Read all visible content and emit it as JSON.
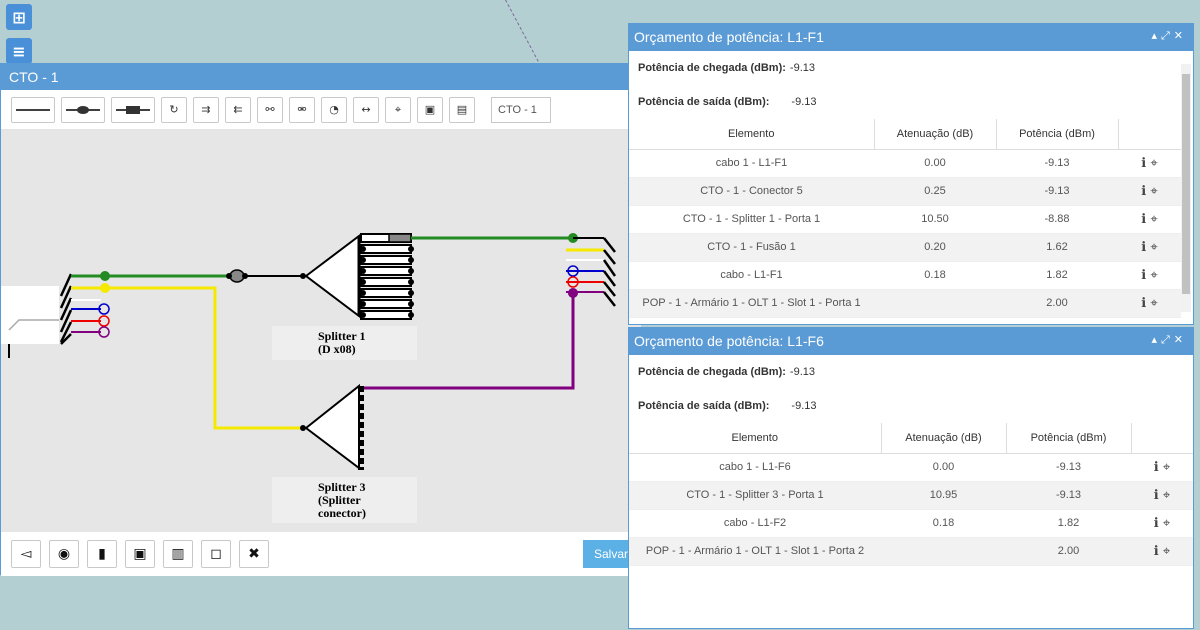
{
  "sidebar": {
    "add_icon": "plus-square-icon",
    "menu_icon": "menu-icon"
  },
  "cto": {
    "title": "CTO - 1",
    "name_value": "CTO - 1",
    "save_label": "Salvar",
    "splitters": [
      {
        "name": "Splitter 1",
        "detail": "(D x08)"
      },
      {
        "name": "Splitter 3",
        "detail": "(Splitter",
        "detail2": "conector)"
      }
    ]
  },
  "budgets": [
    {
      "title": "Orçamento de potência: L1-F1",
      "arrival_label": "Potência de chegada (dBm):",
      "arrival_value": "-9.13",
      "output_label": "Potência de saída (dBm):",
      "output_value": "-9.13",
      "headers": [
        "Elemento",
        "Atenuação (dB)",
        "Potência (dBm)"
      ],
      "rows": [
        {
          "element": "cabo 1 - L1-F1",
          "att": "0.00",
          "pow": "-9.13"
        },
        {
          "element": "CTO - 1 - Conector 5",
          "att": "0.25",
          "pow": "-9.13"
        },
        {
          "element": "CTO - 1 - Splitter 1 - Porta 1",
          "att": "10.50",
          "pow": "-8.88"
        },
        {
          "element": "CTO - 1 - Fusão 1",
          "att": "0.20",
          "pow": "1.62"
        },
        {
          "element": "cabo - L1-F1",
          "att": "0.18",
          "pow": "1.82"
        },
        {
          "element": "POP - 1 - Armário 1 - OLT 1 - Slot 1 - Porta 1",
          "att": "",
          "pow": "2.00"
        }
      ]
    },
    {
      "title": "Orçamento de potência: L1-F6",
      "arrival_label": "Potência de chegada (dBm):",
      "arrival_value": "-9.13",
      "output_label": "Potência de saída (dBm):",
      "output_value": "-9.13",
      "headers": [
        "Elemento",
        "Atenuação (dB)",
        "Potência (dBm)"
      ],
      "rows": [
        {
          "element": "cabo 1 - L1-F6",
          "att": "0.00",
          "pow": "-9.13"
        },
        {
          "element": "CTO - 1 - Splitter 3 - Porta 1",
          "att": "10.95",
          "pow": "-9.13"
        },
        {
          "element": "cabo - L1-F2",
          "att": "0.18",
          "pow": "1.82"
        },
        {
          "element": "POP - 1 - Armário 1 - OLT 1 - Slot 1 - Porta 2",
          "att": "",
          "pow": "2.00"
        }
      ]
    }
  ],
  "colors": {
    "header_blue": "#5b9bd5",
    "fiber_green": "#228b22",
    "fiber_yellow": "#f5e900",
    "fiber_purple": "#800080"
  }
}
